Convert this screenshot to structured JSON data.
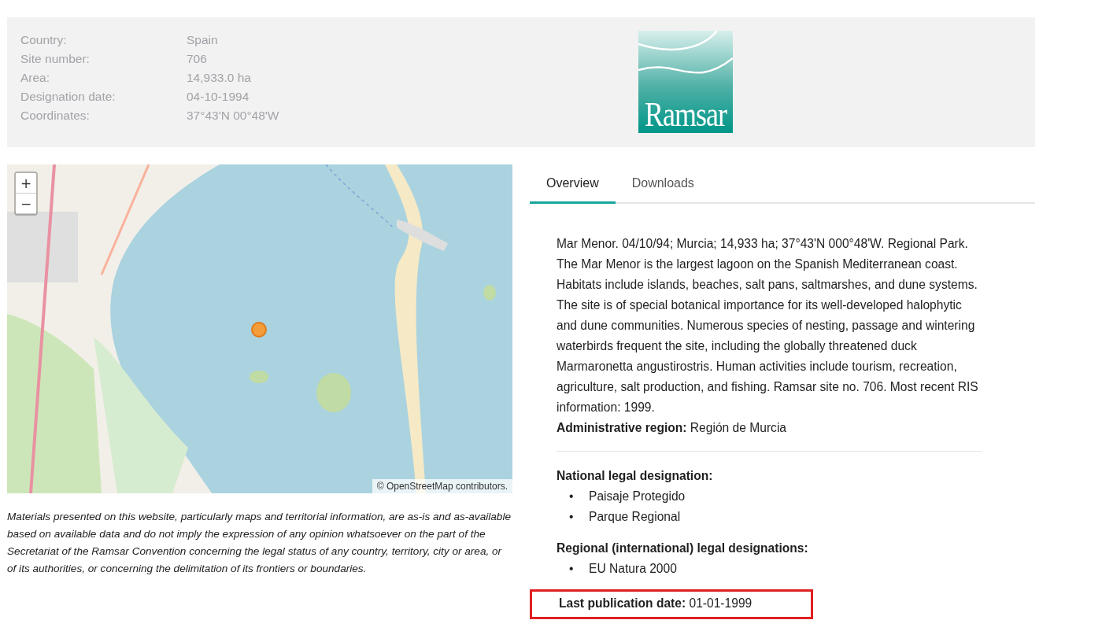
{
  "summary": {
    "fields": [
      {
        "label": "Country:",
        "value": "Spain"
      },
      {
        "label": "Site number:",
        "value": "706"
      },
      {
        "label": "Area:",
        "value": "14,933.0 ha"
      },
      {
        "label": "Designation date:",
        "value": "04-10-1994"
      },
      {
        "label": "Coordinates:",
        "value": "37°43'N 00°48'W"
      }
    ],
    "logo_text": "Ramsar"
  },
  "map": {
    "kind": "picture",
    "zoom_in": "+",
    "zoom_out": "−",
    "attribution": "© OpenStreetMap contributors."
  },
  "disclaimer": "Materials presented on this website, particularly maps and territorial information, are as-is and as-available based on available data and do not imply the expression of any opinion whatsoever on the part of the Secretariat of the Ramsar Convention concerning the legal status of any country, territory, city or area, or of its authorities, or concerning the delimitation of its frontiers or boundaries.",
  "tabs": [
    {
      "label": "Overview",
      "selected": true
    },
    {
      "label": "Downloads",
      "selected": false
    }
  ],
  "overview": {
    "description": "Mar Menor. 04/10/94; Murcia; 14,933 ha; 37°43'N 000°48'W. Regional Park. The Mar Menor is the largest lagoon on the Spanish Mediterranean coast. Habitats include islands, beaches, salt pans, saltmarshes, and dune systems. The site is of special botanical importance for its well-developed halophytic and dune communities. Numerous species of nesting, passage and wintering waterbirds frequent the site, including the globally threatened duck Marmaronetta angustirostris. Human activities include tourism, recreation, agriculture, salt production, and fishing. Ramsar site no. 706. Most recent RIS information: 1999.",
    "administrative_region": "**Administrative region:** Región de Murcia",
    "national_heading": "National legal designation:",
    "bullet": "•",
    "national_items": [
      "Paisaje Protegido",
      "Parque Regional"
    ],
    "regional_heading": "Regional (international) legal designations:",
    "regional_items": [
      "EU Natura 2000"
    ],
    "last_publication": {
      "text": "**Last publication date:** 01-01-1999",
      "highlighted": true
    }
  }
}
